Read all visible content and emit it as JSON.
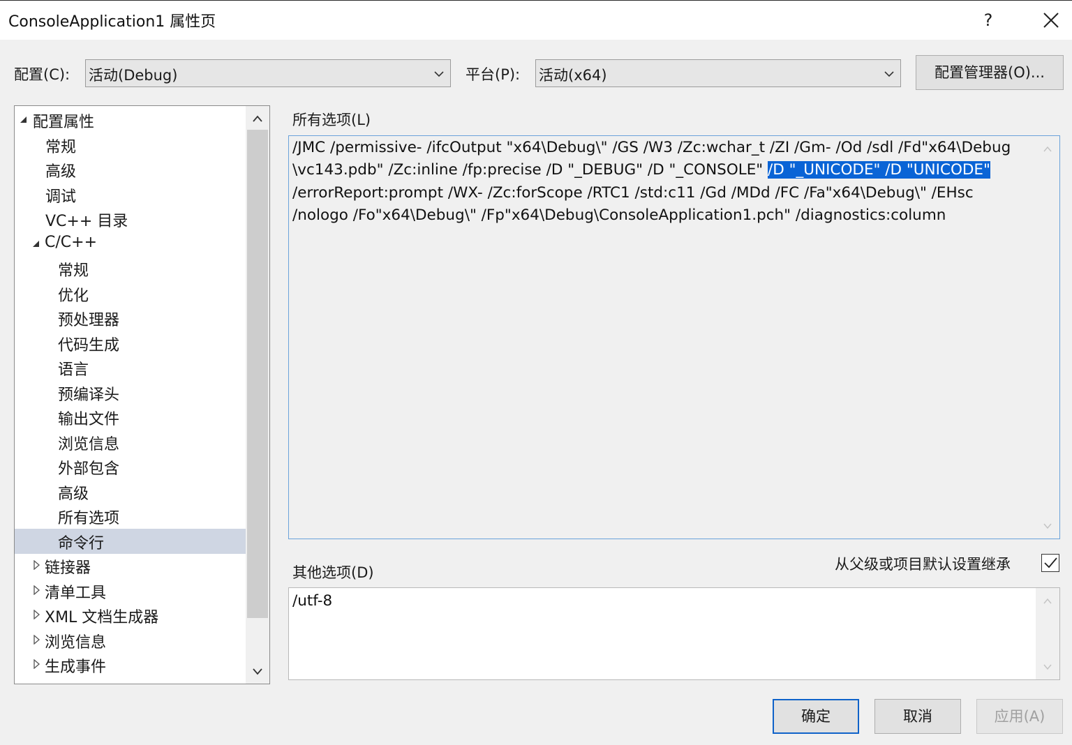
{
  "window": {
    "title": "ConsoleApplication1 属性页",
    "help_label": "?"
  },
  "config_bar": {
    "config_label": "配置(C):",
    "config_value": "活动(Debug)",
    "platform_label": "平台(P):",
    "platform_value": "活动(x64)",
    "manager_button": "配置管理器(O)..."
  },
  "tree": {
    "items": [
      {
        "label": "配置属性",
        "toggle": "expanded"
      },
      {
        "label": "常规"
      },
      {
        "label": "高级"
      },
      {
        "label": "调试"
      },
      {
        "label": "VC++ 目录"
      },
      {
        "label": "C/C++",
        "toggle": "expanded"
      },
      {
        "label": "常规"
      },
      {
        "label": "优化"
      },
      {
        "label": "预处理器"
      },
      {
        "label": "代码生成"
      },
      {
        "label": "语言"
      },
      {
        "label": "预编译头"
      },
      {
        "label": "输出文件"
      },
      {
        "label": "浏览信息"
      },
      {
        "label": "外部包含"
      },
      {
        "label": "高级"
      },
      {
        "label": "所有选项"
      },
      {
        "label": "命令行",
        "selected": true
      },
      {
        "label": "链接器",
        "toggle": "collapsed"
      },
      {
        "label": "清单工具",
        "toggle": "collapsed"
      },
      {
        "label": "XML 文档生成器",
        "toggle": "collapsed"
      },
      {
        "label": "浏览信息",
        "toggle": "collapsed"
      },
      {
        "label": "生成事件",
        "toggle": "collapsed"
      }
    ]
  },
  "all_options": {
    "label": "所有选项(L)",
    "lines": [
      "/JMC /permissive- /ifcOutput \"x64\\Debug\\\" /GS /W3 /Zc:wchar_t /ZI /Gm- /Od /sdl /Fd\"x64\\Debug",
      "\\vc143.pdb\" /Zc:inline /fp:precise /D \"_DEBUG\" /D \"_CONSOLE\" ",
      "/errorReport:prompt /WX- /Zc:forScope /RTC1 /std:c11 /Gd /MDd /FC /Fa\"x64\\Debug\\\" /EHsc",
      "/nologo /Fo\"x64\\Debug\\\" /Fp\"x64\\Debug\\ConsoleApplication1.pch\" /diagnostics:column"
    ],
    "selected_text": "/D \"_UNICODE\" /D \"UNICODE\""
  },
  "other_options": {
    "label": "其他选项(D)",
    "inherit_label": "从父级或项目默认设置继承",
    "inherit_checked": true,
    "value": "/utf-8"
  },
  "buttons": {
    "ok": "确定",
    "cancel": "取消",
    "apply": "应用(A)"
  },
  "colors": {
    "selection": "#0a64d6",
    "tree_selected": "#cfd6e3",
    "focus_border": "#0f62c9"
  }
}
